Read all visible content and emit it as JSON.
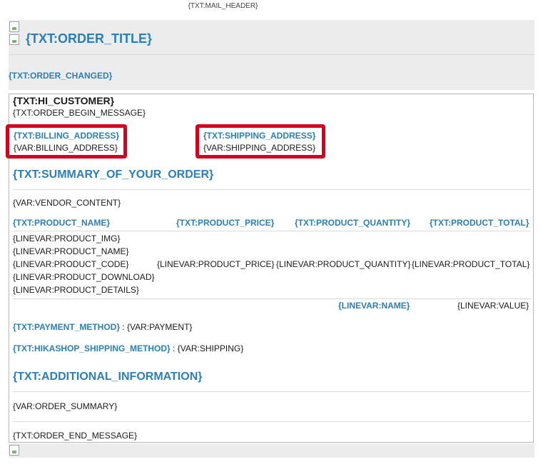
{
  "mail_header": "{TXT:MAIL_HEADER}",
  "order_title": "{TXT:ORDER_TITLE}",
  "order_changed": "{TXT:ORDER_CHANGED}",
  "hi_customer": "{TXT:HI_CUSTOMER}",
  "order_begin_message": "{TXT:ORDER_BEGIN_MESSAGE}",
  "billing": {
    "label": "{TXT:BILLING_ADDRESS}",
    "value": "{VAR:BILLING_ADDRESS}"
  },
  "shipping": {
    "label": "{TXT:SHIPPING_ADDRESS}",
    "value": "{VAR:SHIPPING_ADDRESS}"
  },
  "summary_title": "{TXT:SUMMARY_OF_YOUR_ORDER}",
  "vendor_content": "{VAR:VENDOR_CONTENT}",
  "columns": {
    "name": "{TXT:PRODUCT_NAME}",
    "price": "{TXT:PRODUCT_PRICE}",
    "quantity": "{TXT:PRODUCT_QUANTITY}",
    "total": "{TXT:PRODUCT_TOTAL}"
  },
  "product_lines": {
    "img": "{LINEVAR:PRODUCT_IMG}",
    "name": "{LINEVAR:PRODUCT_NAME}",
    "code": "{LINEVAR:PRODUCT_CODE}",
    "download": "{LINEVAR:PRODUCT_DOWNLOAD}",
    "details": "{LINEVAR:PRODUCT_DETAILS}",
    "price": "{LINEVAR:PRODUCT_PRICE}",
    "quantity": "{LINEVAR:PRODUCT_QUANTITY}",
    "total": "{LINEVAR:PRODUCT_TOTAL}"
  },
  "line_name": "{LINEVAR:NAME}",
  "line_value": "{LINEVAR:VALUE}",
  "payment": {
    "label": "{TXT:PAYMENT_METHOD}",
    "sep": " : ",
    "value": "{VAR:PAYMENT}"
  },
  "shipping_method": {
    "label": "{TXT:HIKASHOP_SHIPPING_METHOD}",
    "sep": " : ",
    "value": "{VAR:SHIPPING}"
  },
  "additional_title": "{TXT:ADDITIONAL_INFORMATION}",
  "order_summary": "{VAR:ORDER_SUMMARY}",
  "order_end_message": "{TXT:ORDER_END_MESSAGE}",
  "colors": {
    "accent": "#2b7fb8",
    "highlight": "#d5001c",
    "panel": "#ececec"
  }
}
